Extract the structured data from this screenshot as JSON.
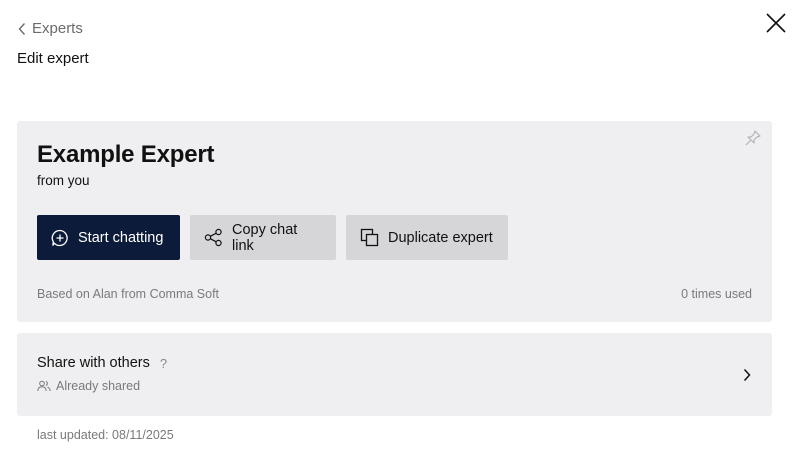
{
  "nav": {
    "back_label": "Experts",
    "page_title": "Edit expert"
  },
  "expert": {
    "name": "Example Expert",
    "origin": "from you",
    "based_on": "Based on Alan from Comma Soft",
    "times_used": "0 times used"
  },
  "actions": {
    "start_chatting": "Start chatting",
    "copy_link": "Copy chat link",
    "duplicate": "Duplicate expert"
  },
  "share": {
    "title": "Share with others",
    "help": "?",
    "status": "Already shared"
  },
  "footer": {
    "last_updated": "last updated: 08/11/2025"
  },
  "colors": {
    "primary_button": "#0d1b3a",
    "card_background": "#efeff1",
    "secondary_button": "#d6d6d9"
  },
  "icons": [
    "chevron-left-icon",
    "close-icon",
    "pin-icon",
    "chat-plus-icon",
    "share-nodes-icon",
    "duplicate-icon",
    "users-icon",
    "chevron-right-icon"
  ]
}
